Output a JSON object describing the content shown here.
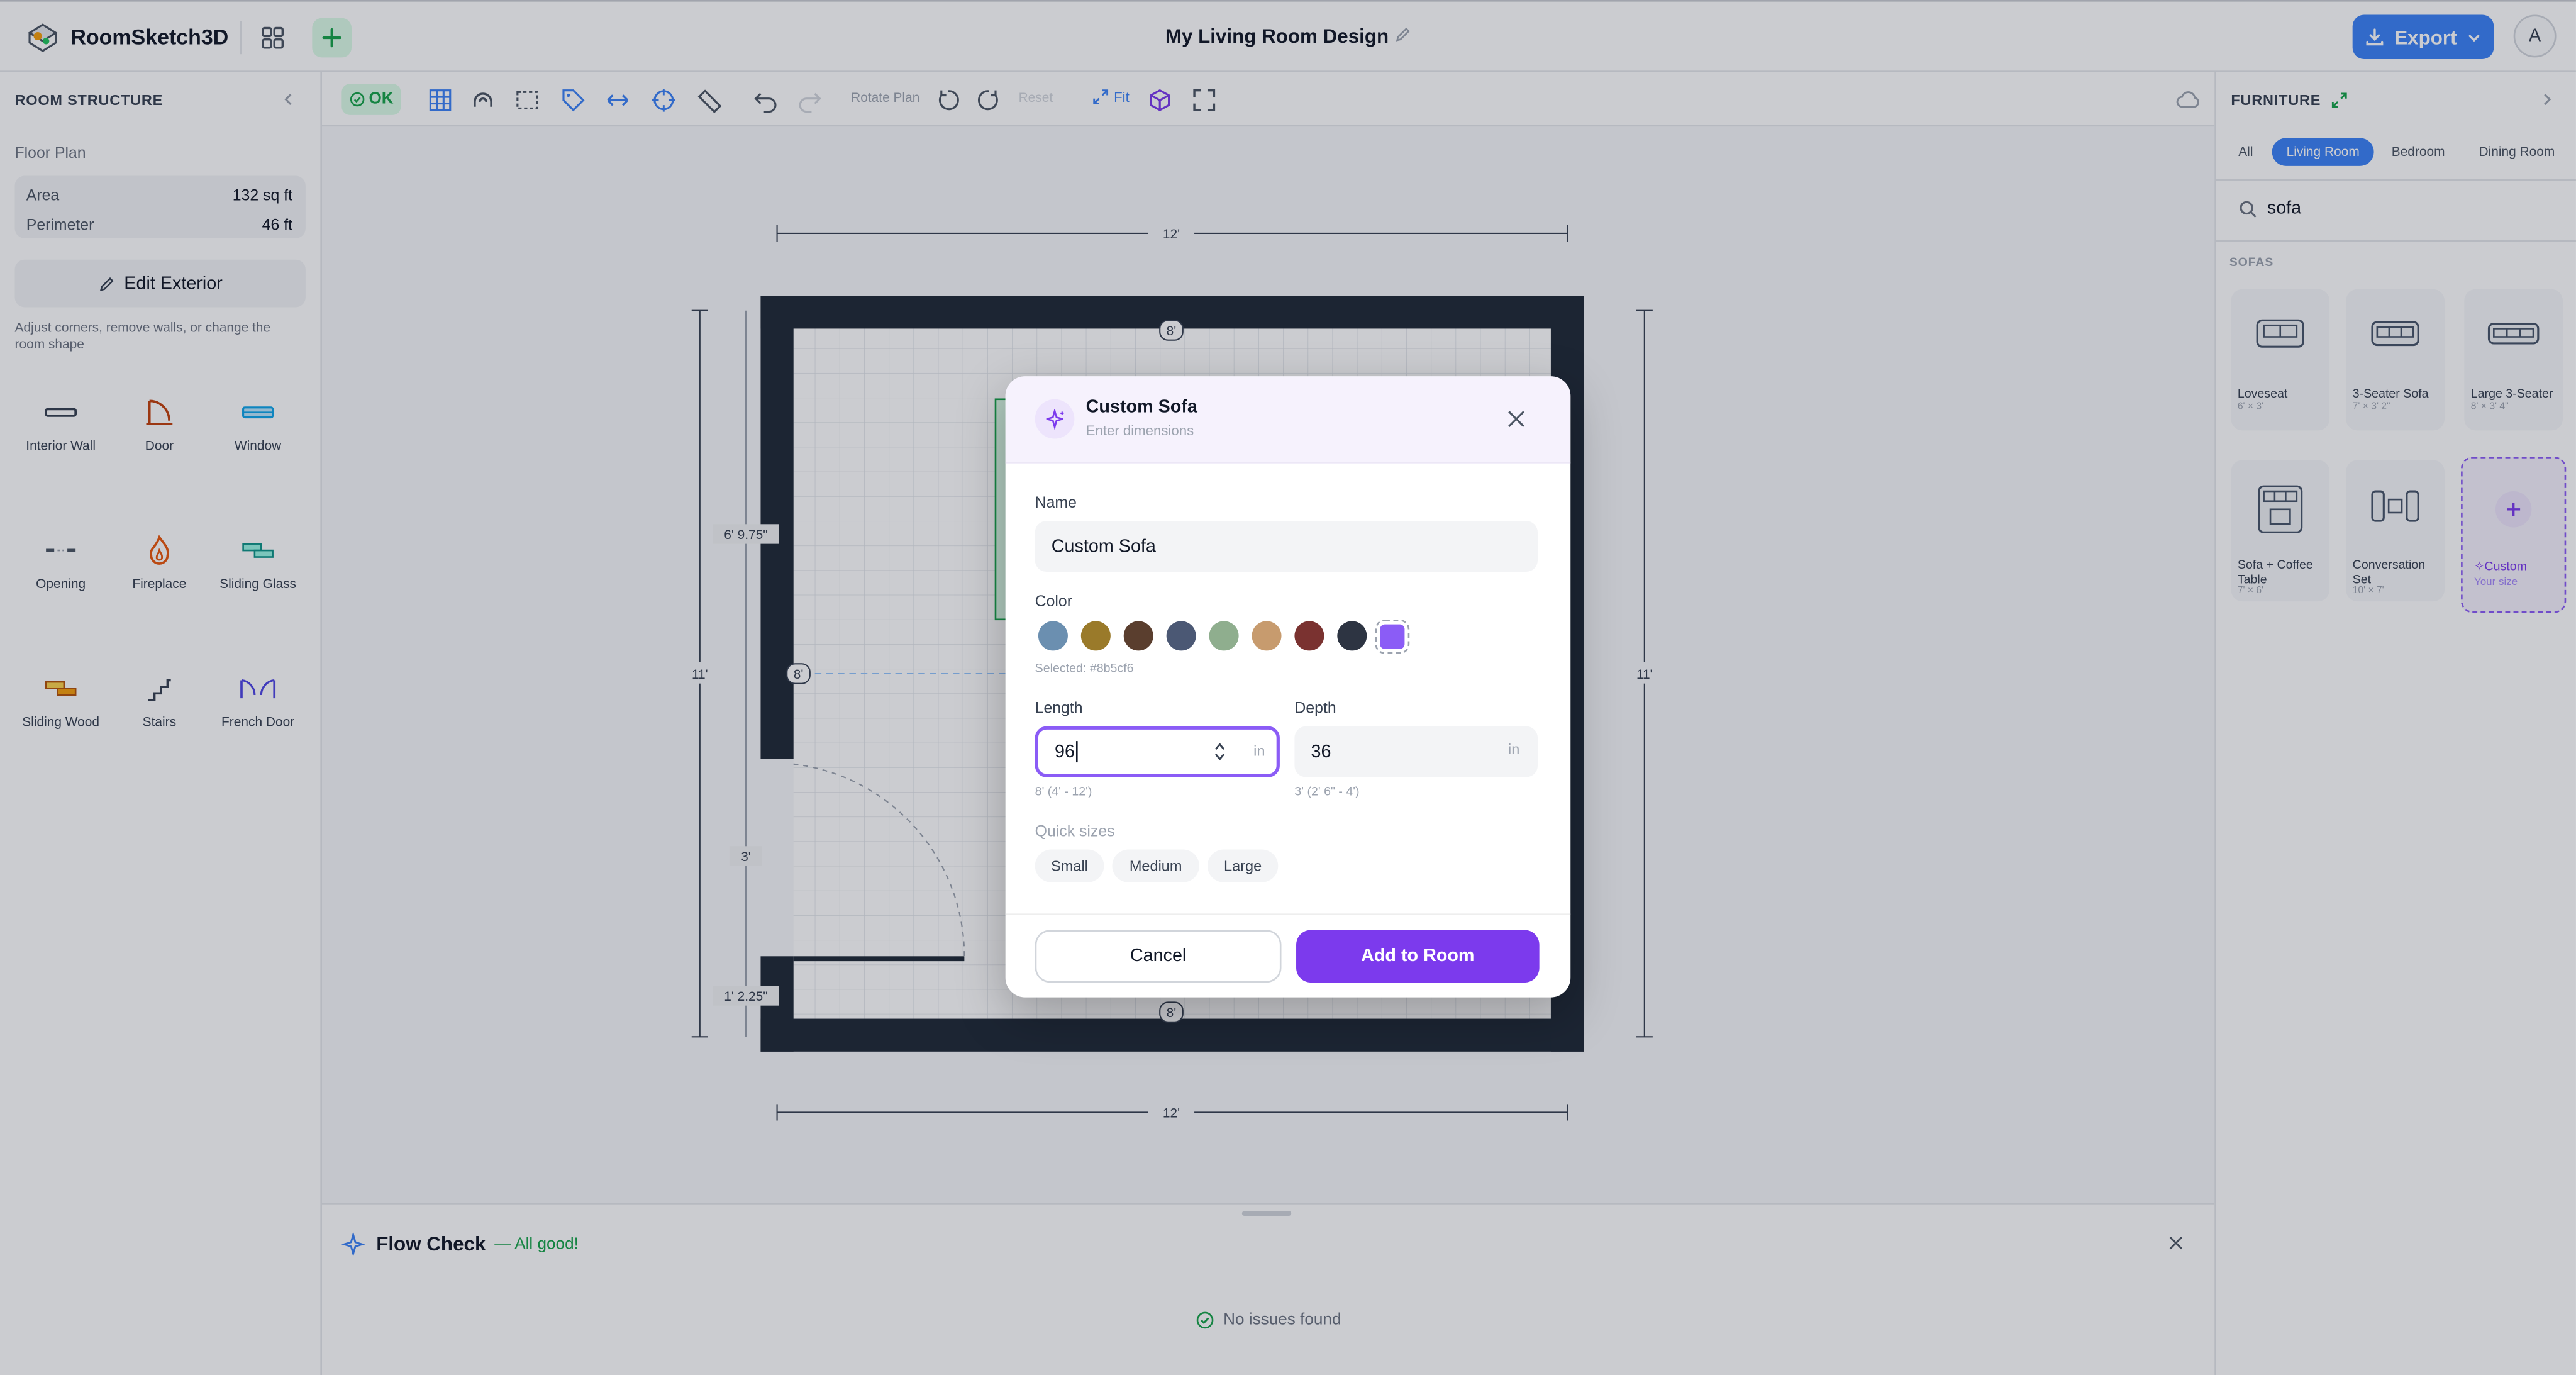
{
  "app": {
    "name": "RoomSketch3D",
    "doc_title": "My Living Room Design",
    "export_label": "Export",
    "avatar_initial": "A",
    "accent": "#3b82f6"
  },
  "left_panel": {
    "title": "ROOM STRUCTURE",
    "floor_plan_label": "Floor Plan",
    "area_label": "Area",
    "area_value": "132 sq ft",
    "perimeter_label": "Perimeter",
    "perimeter_value": "46 ft",
    "edit_exterior_label": "Edit Exterior",
    "hint": "Adjust corners, remove walls, or change the room shape",
    "tools": [
      {
        "label": "Interior Wall",
        "icon": "interior-wall-icon"
      },
      {
        "label": "Door",
        "icon": "door-icon"
      },
      {
        "label": "Window",
        "icon": "window-icon"
      },
      {
        "label": "Opening",
        "icon": "opening-icon"
      },
      {
        "label": "Fireplace",
        "icon": "fireplace-icon"
      },
      {
        "label": "Sliding Glass",
        "icon": "sliding-glass-icon"
      },
      {
        "label": "Sliding Wood",
        "icon": "sliding-wood-icon"
      },
      {
        "label": "Stairs",
        "icon": "stairs-icon"
      },
      {
        "label": "French Door",
        "icon": "french-door-icon"
      }
    ]
  },
  "toolbar": {
    "status": "OK",
    "rotate_label": "Rotate Plan",
    "reset_label": "Reset",
    "fit_label": "Fit"
  },
  "plan": {
    "top_dim": "12'",
    "bottom_dim": "12'",
    "left_dim": "11'",
    "right_dim": "11'",
    "wall_top": "8'",
    "wall_bottom": "8'",
    "wall_left": "8'",
    "seg1": "6' 9.75\"",
    "seg2": "3'",
    "seg3": "1' 2.25\""
  },
  "flow_check": {
    "title": "Flow Check",
    "status": "— All good!",
    "message": "No issues found"
  },
  "right_panel": {
    "title": "FURNITURE",
    "tabs": [
      "All",
      "Living Room",
      "Bedroom",
      "Dining Room"
    ],
    "active_tab": "Living Room",
    "search_value": "sofa",
    "section": "SOFAS",
    "items": [
      {
        "name": "Loveseat",
        "dims": "6' × 3'"
      },
      {
        "name": "3-Seater Sofa",
        "dims": "7' × 3' 2\""
      },
      {
        "name": "Large 3-Seater",
        "dims": "8' × 3' 4\""
      },
      {
        "name": "Sofa + Coffee Table",
        "dims": "7' × 6'"
      },
      {
        "name": "Conversation Set",
        "dims": "10' × 7'"
      }
    ],
    "custom_label": "Custom",
    "custom_sub": "Your size"
  },
  "modal": {
    "title": "Custom Sofa",
    "subtitle": "Enter dimensions",
    "name_label": "Name",
    "name_value": "Custom Sofa",
    "color_label": "Color",
    "colors": [
      "#6b8fb0",
      "#9a7a2a",
      "#5a3e2e",
      "#4b5874",
      "#8fae8e",
      "#c79b6e",
      "#7a3230",
      "#2d3442",
      "#8b5cf6"
    ],
    "selected_text": "Selected: #8b5cf6",
    "length_label": "Length",
    "length_value": "96",
    "length_unit": "in",
    "length_hint": "8' (4' - 12')",
    "depth_label": "Depth",
    "depth_value": "36",
    "depth_unit": "in",
    "depth_hint": "3' (2' 6\" - 4')",
    "quick_label": "Quick sizes",
    "quick": [
      "Small",
      "Medium",
      "Large"
    ],
    "cancel_label": "Cancel",
    "add_label": "Add to Room",
    "primary": "#7c3aed"
  }
}
